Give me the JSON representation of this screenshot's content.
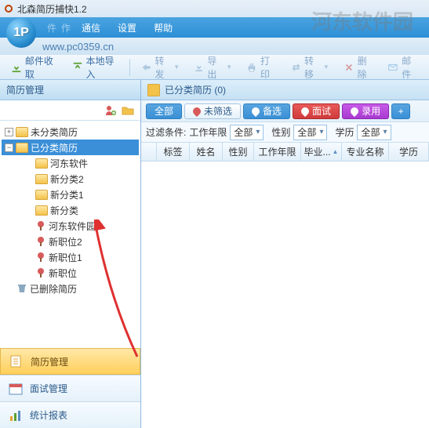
{
  "window": {
    "title": "北森简历捕快1.2"
  },
  "menu": {
    "items": [
      "通信",
      "设置",
      "帮助"
    ],
    "hidden1": "件",
    "hidden2": "作"
  },
  "watermark": "河东软件园",
  "url_strip": "www.pc0359.cn",
  "toolbar": {
    "receive": "邮件收取",
    "import": "本地导入",
    "forward": "转发",
    "export": "导出",
    "print": "打印",
    "transfer": "转移",
    "delete": "删除",
    "mail": "邮件"
  },
  "sidebar": {
    "title": "简历管理",
    "tree": {
      "unclassified": "未分类简历",
      "classified": "已分类简历",
      "children": [
        "河东软件",
        "新分类2",
        "新分类1",
        "新分类",
        "河东软件园",
        "新职位2",
        "新职位1",
        "新职位"
      ],
      "deleted": "已删除简历"
    },
    "bottom": {
      "resume": "简历管理",
      "interview": "面试管理",
      "stats": "统计报表"
    }
  },
  "content": {
    "header": "已分类简历 (0)",
    "tabs": {
      "all": "全部",
      "unfiltered": "未筛选",
      "bookmark": "备选",
      "interview": "面试",
      "hired": "录用",
      "plus": "+"
    },
    "filter": {
      "label": "过滤条件:",
      "workyears": "工作年限",
      "all": "全部",
      "gender": "性别",
      "education": "学历"
    },
    "columns": [
      "",
      "标签",
      "姓名",
      "性别",
      "工作年限",
      "毕业...",
      "专业名称",
      "学历"
    ]
  }
}
